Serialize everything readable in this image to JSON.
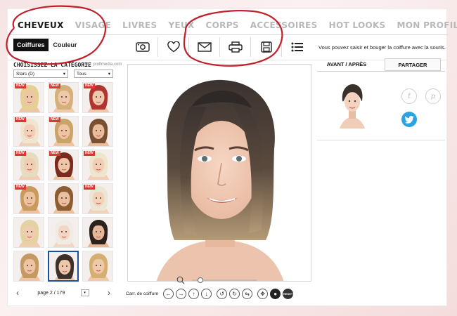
{
  "nav": {
    "items": [
      {
        "label": "CHEVEUX",
        "active": true
      },
      {
        "label": "VISAGE",
        "active": false
      },
      {
        "label": "LIVRES",
        "active": false
      },
      {
        "label": "YEUX",
        "active": false
      },
      {
        "label": "CORPS",
        "active": false
      },
      {
        "label": "ACCESSOIRES",
        "active": false
      },
      {
        "label": "HOT LOOKS",
        "active": false
      },
      {
        "label": "MON PROFIL",
        "active": false
      }
    ]
  },
  "subtabs": {
    "hairstyles": "Coiffures",
    "color": "Couleur"
  },
  "toolbar": {
    "icons": [
      "camera-icon",
      "heart-icon",
      "envelope-icon",
      "printer-icon",
      "save-icon",
      "list-icon"
    ]
  },
  "hint": "Vous pouvez saisir et bouger la coiffure avec la souris.",
  "left_panel": {
    "category_title": "CHOISISSEZ LA CATÉGORIE",
    "photo_credit": "foto: profimedia.com",
    "category_select": "Stars (D)",
    "filter_select": "Tous",
    "thumbs": [
      {
        "new": true,
        "hair": "#e6cf93",
        "skin": "#edc6a6"
      },
      {
        "new": true,
        "hair": "#d6b07a",
        "skin": "#f0c9aa"
      },
      {
        "new": true,
        "hair": "#b0352e",
        "skin": "#f0c9ac"
      },
      {
        "new": true,
        "hair": "#f0e6cf",
        "skin": "#f2d0b8"
      },
      {
        "new": true,
        "hair": "#c8a468",
        "skin": "#eec4a2"
      },
      {
        "new": false,
        "hair": "#7a5030",
        "skin": "#e9bc9c"
      },
      {
        "new": true,
        "hair": "#e6dcc0",
        "skin": "#f0cdb3"
      },
      {
        "new": true,
        "hair": "#7a2a1e",
        "skin": "#efc6a8"
      },
      {
        "new": true,
        "hair": "#efe4cc",
        "skin": "#f2cfb4"
      },
      {
        "new": true,
        "hair": "#c89a5e",
        "skin": "#eec29f"
      },
      {
        "new": false,
        "hair": "#8c5c33",
        "skin": "#ebc09e"
      },
      {
        "new": true,
        "hair": "#ece6d6",
        "skin": "#f3d2ba"
      },
      {
        "new": false,
        "hair": "#e4d2a2",
        "skin": "#f0ccb0"
      },
      {
        "new": false,
        "hair": "#efece6",
        "skin": "#f4d6c4"
      },
      {
        "new": false,
        "hair": "#2c211b",
        "skin": "#e6b898"
      },
      {
        "new": false,
        "hair": "#c49a62",
        "skin": "#eec4a3"
      },
      {
        "new": false,
        "hair": "#3d3028",
        "skin": "#eec8ab",
        "selected": true
      },
      {
        "new": false,
        "hair": "#d6ae72",
        "skin": "#f0c9aa"
      }
    ],
    "page_label": "page 2 / 179"
  },
  "preview": {
    "hair_color": "#3b3330",
    "hair_tip": "#b49a76"
  },
  "controls": {
    "label": "Carr. de coiffure"
  },
  "right_panel": {
    "tab_before_after": "AVANT / APRÈS",
    "tab_share": "PARTAGER"
  },
  "colors": {
    "annotation_red": "#c0202a",
    "twitter_blue": "#2aa3e3"
  }
}
